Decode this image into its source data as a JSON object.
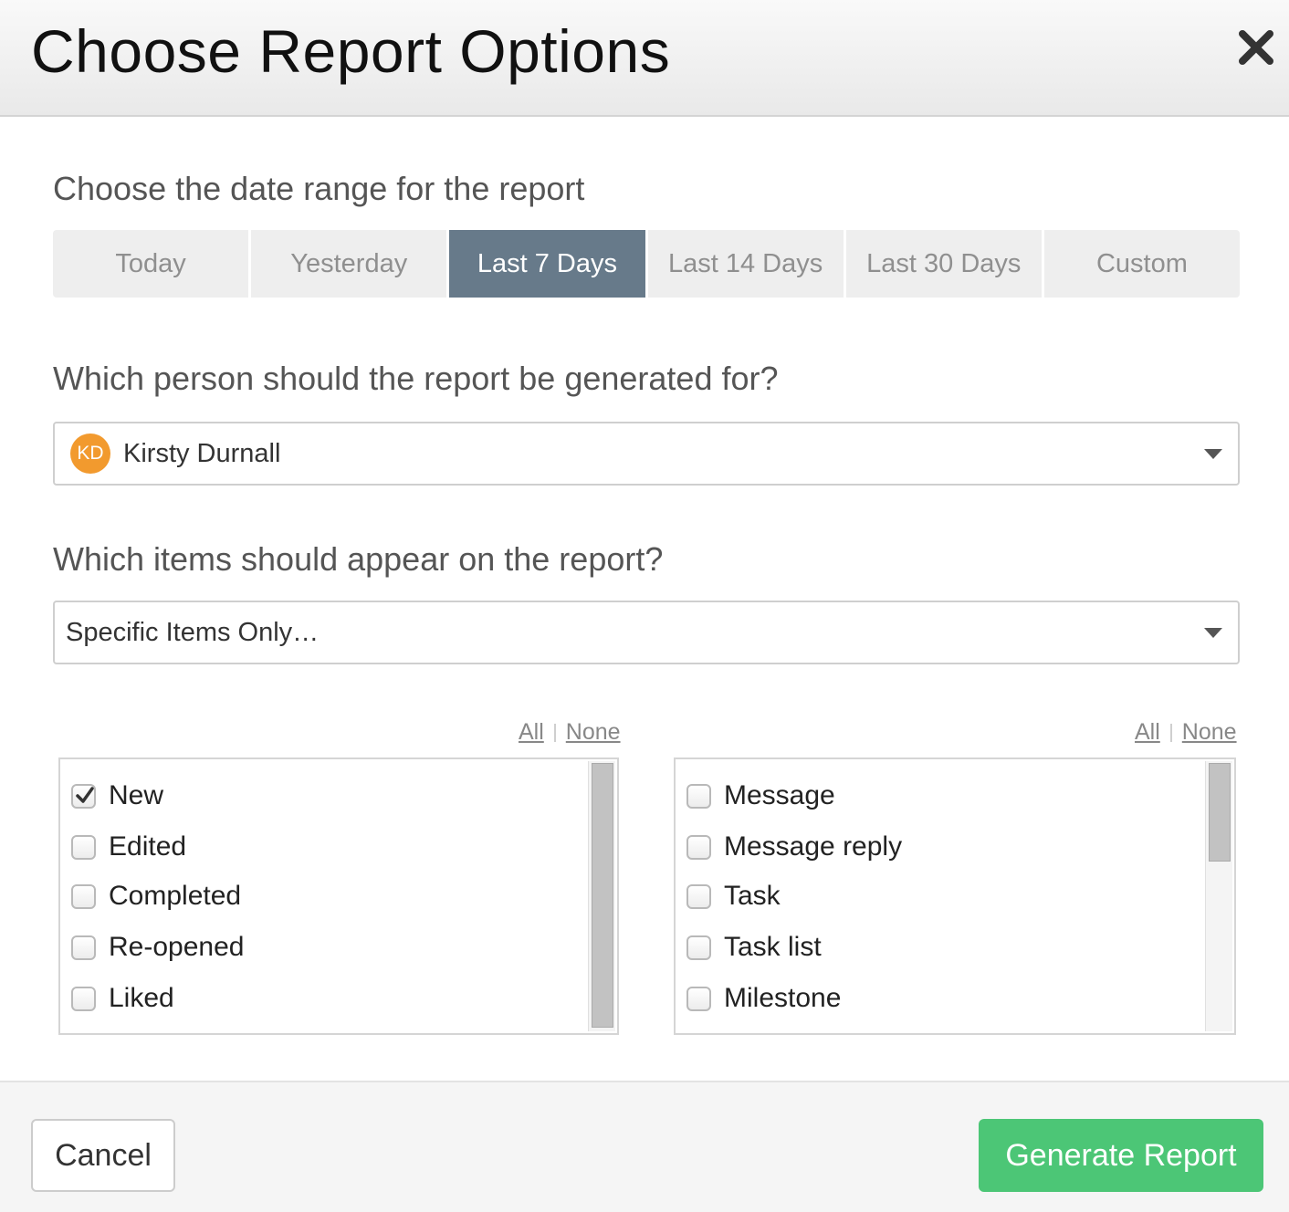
{
  "dialog": {
    "title": "Choose Report Options",
    "close_icon": "close-icon"
  },
  "date_range": {
    "heading": "Choose the date range for the report",
    "tabs": [
      {
        "label": "Today",
        "active": false
      },
      {
        "label": "Yesterday",
        "active": false
      },
      {
        "label": "Last 7 Days",
        "active": true
      },
      {
        "label": "Last 14 Days",
        "active": false
      },
      {
        "label": "Last 30 Days",
        "active": false
      },
      {
        "label": "Custom",
        "active": false
      }
    ],
    "active_color": "#677a8a"
  },
  "person": {
    "heading": "Which person should the report be generated for?",
    "selected_initials": "KD",
    "selected_name": "Kirsty Durnall",
    "avatar_color": "#f29a2e"
  },
  "items": {
    "heading": "Which items should appear on the report?",
    "selected": "Specific Items Only…"
  },
  "event_list": {
    "all_label": "All",
    "none_label": "None",
    "options": [
      {
        "label": "New",
        "checked": true
      },
      {
        "label": "Edited",
        "checked": false
      },
      {
        "label": "Completed",
        "checked": false
      },
      {
        "label": "Re-opened",
        "checked": false
      },
      {
        "label": "Liked",
        "checked": false
      }
    ]
  },
  "type_list": {
    "all_label": "All",
    "none_label": "None",
    "options": [
      {
        "label": "Message",
        "checked": false
      },
      {
        "label": "Message reply",
        "checked": false
      },
      {
        "label": "Task",
        "checked": false
      },
      {
        "label": "Task list",
        "checked": false
      },
      {
        "label": "Milestone",
        "checked": false
      }
    ]
  },
  "footer": {
    "cancel_label": "Cancel",
    "generate_label": "Generate Report",
    "generate_color": "#4cc676"
  }
}
